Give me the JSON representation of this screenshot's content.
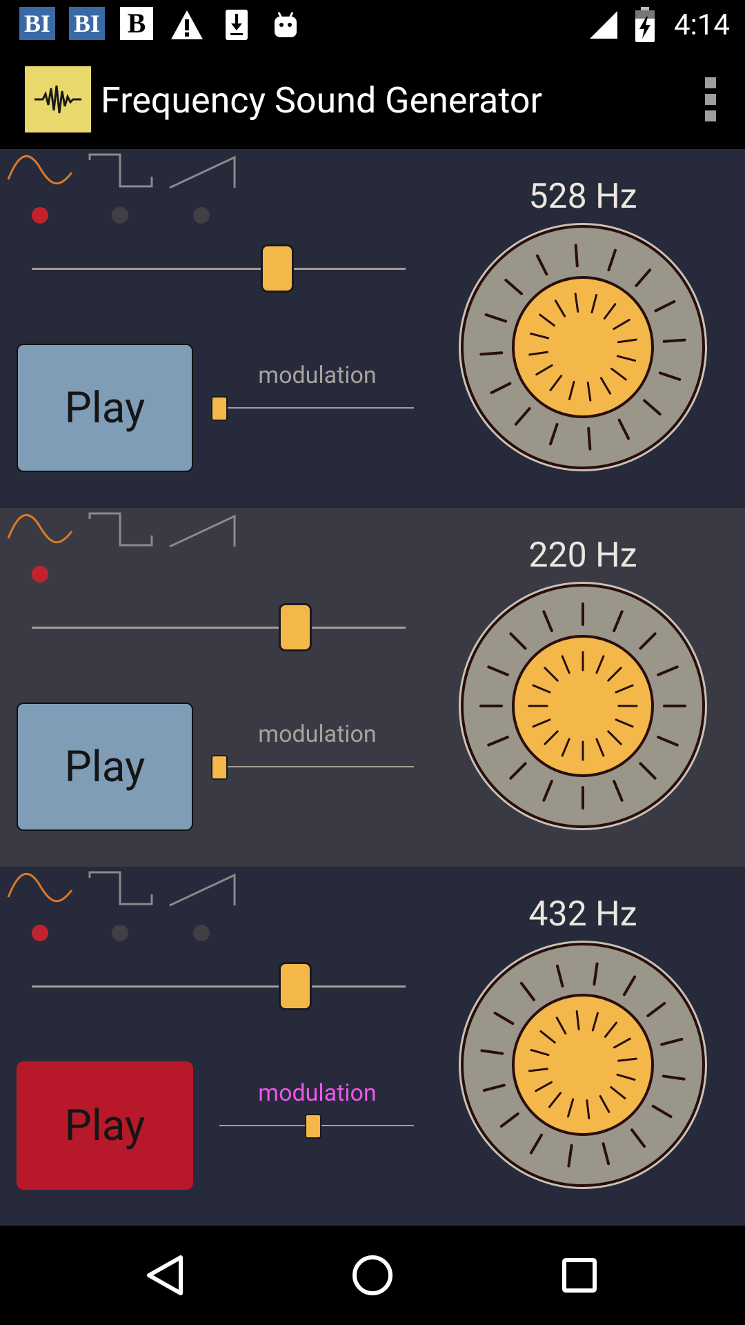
{
  "status_bar": {
    "time": "4:14",
    "notification_icons": [
      "bi-icon",
      "bi-icon",
      "b-icon",
      "warning-icon",
      "download-icon",
      "android-icon"
    ],
    "bi_label": "BI",
    "b_label": "B",
    "right_icons": [
      "signal-icon",
      "battery-charging-icon"
    ]
  },
  "app_bar": {
    "title": "Frequency Sound Generator",
    "logo_icon": "waveform-icon",
    "menu_icon": "overflow-menu-icon"
  },
  "colors": {
    "panel_dark": "#262a3a",
    "panel_light": "#3a3a44",
    "accent_yellow": "#f4b84a",
    "dial_outer": "#9b968a",
    "play_idle": "#7f9db6",
    "play_active": "#b8192a",
    "selected_dot": "#c2222d",
    "modulation_active": "#ee55ee"
  },
  "waveforms": [
    "sine",
    "square",
    "sawtooth"
  ],
  "panels": [
    {
      "frequency": "528 Hz",
      "selected_waveform": "sine",
      "play_label": "Play",
      "playing": false,
      "modulation_label": "modulation",
      "modulation_active": false,
      "volume": 0.66,
      "modulation": 0.0
    },
    {
      "frequency": "220 Hz",
      "selected_waveform": "sine",
      "play_label": "Play",
      "playing": false,
      "modulation_label": "modulation",
      "modulation_active": false,
      "volume": 0.71,
      "modulation": 0.0
    },
    {
      "frequency": "432 Hz",
      "selected_waveform": "sine",
      "play_label": "Play",
      "playing": true,
      "modulation_label": "modulation",
      "modulation_active": true,
      "volume": 0.71,
      "modulation": 0.49
    }
  ],
  "nav_bar": {
    "buttons": [
      "back-icon",
      "home-icon",
      "recents-icon"
    ]
  }
}
